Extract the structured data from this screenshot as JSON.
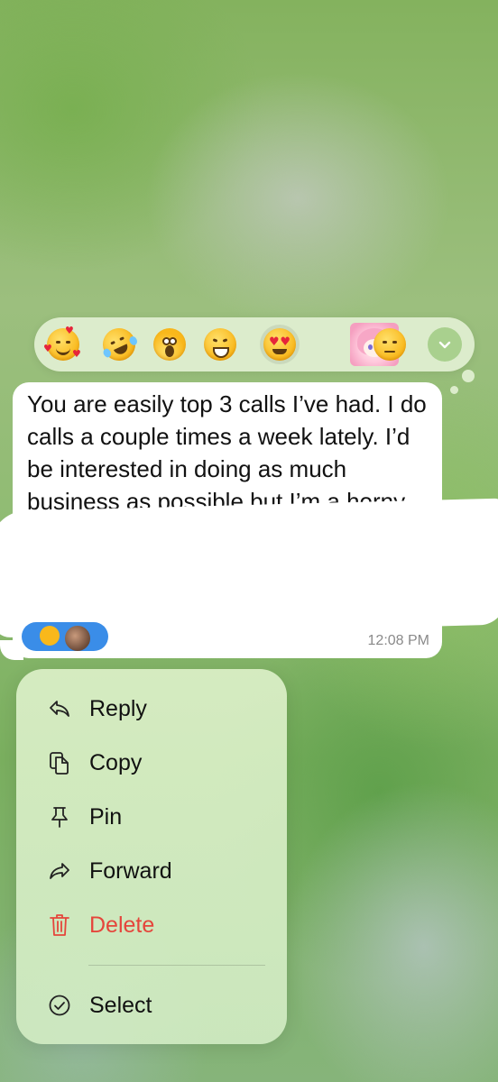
{
  "reaction_bar": {
    "emojis": [
      {
        "name": "smiling-face-with-hearts"
      },
      {
        "name": "rolling-on-floor-laughing"
      },
      {
        "name": "face-screaming-in-fear"
      },
      {
        "name": "grinning-squinting-face"
      },
      {
        "name": "smiling-face-with-heart-eyes",
        "selected": true
      },
      {
        "name": "anime-girl-sticker"
      },
      {
        "name": "unamused-face"
      }
    ]
  },
  "message": {
    "text": "You are easily top 3 calls I’ve had. I do calls a couple times a week lately. I’d be interested in doing as much business as possible but I’m a horny man and",
    "time": "12:08 PM"
  },
  "menu": {
    "items": [
      {
        "label": "Reply",
        "icon": "reply-icon"
      },
      {
        "label": "Copy",
        "icon": "copy-icon"
      },
      {
        "label": "Pin",
        "icon": "pin-icon"
      },
      {
        "label": "Forward",
        "icon": "forward-icon"
      },
      {
        "label": "Delete",
        "icon": "trash-icon",
        "color": "#e5453b"
      },
      {
        "label": "Select",
        "icon": "check-circle-icon"
      }
    ]
  },
  "colors": {
    "accent": "#3a8de8",
    "danger": "#e5453b",
    "bubble": "#ffffff"
  }
}
